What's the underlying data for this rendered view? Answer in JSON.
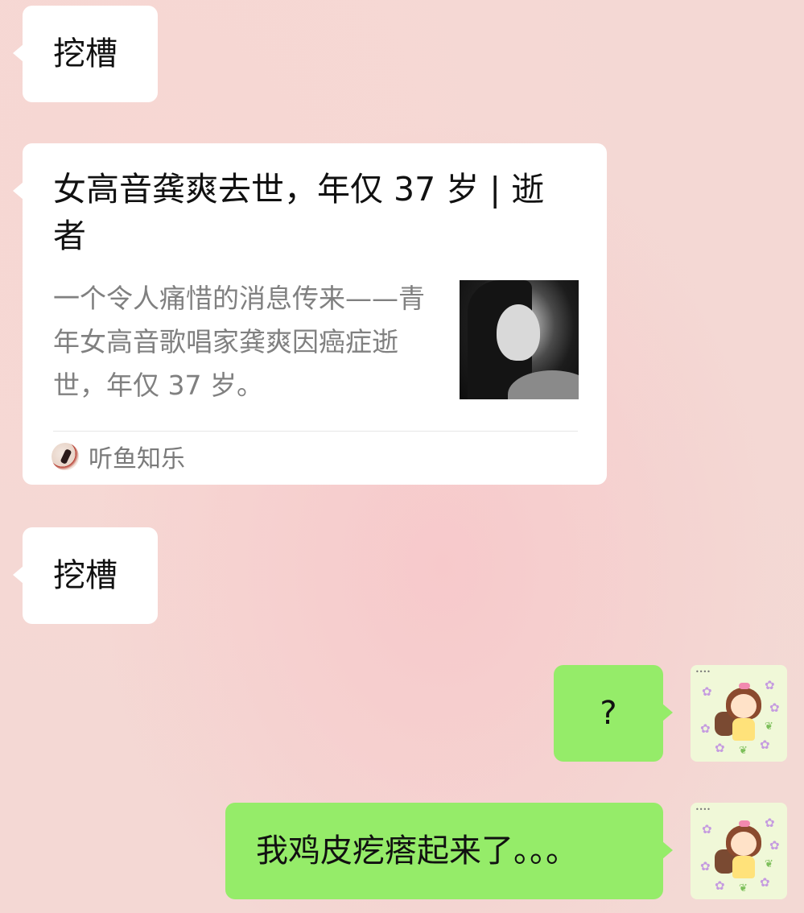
{
  "chat": {
    "messages": [
      {
        "type": "text",
        "direction": "incoming",
        "text": "挖槽"
      },
      {
        "type": "article_card",
        "direction": "incoming",
        "title": "女高音龚爽去世，年仅 37 岁 | 逝者",
        "description": "一个令人痛惜的消息传来——青年女高音歌唱家龚爽因癌症逝世，年仅 37 岁。",
        "source": "听鱼知乐"
      },
      {
        "type": "text",
        "direction": "incoming",
        "text": "挖槽"
      },
      {
        "type": "text",
        "direction": "outgoing",
        "text": "?"
      },
      {
        "type": "text",
        "direction": "outgoing",
        "text": "我鸡皮疙瘩起来了。。。"
      }
    ]
  },
  "colors": {
    "incoming_bubble": "#ffffff",
    "outgoing_bubble": "#95ec69",
    "background": "#f4d8d4",
    "secondary_text": "#808080"
  },
  "icons": {
    "avatar": "cartoon-girl-avatar",
    "source_logo": "source-logo-icon"
  }
}
